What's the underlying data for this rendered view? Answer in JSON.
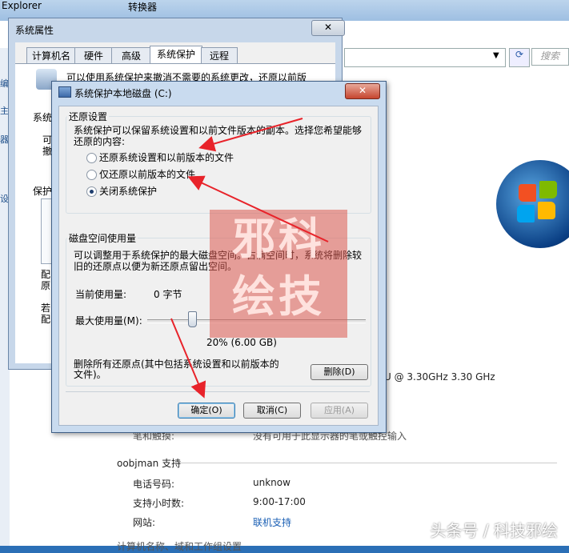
{
  "background_window": {
    "title": "Explorer",
    "title2": "转换器",
    "search_placeholder": "搜索",
    "left_labels": [
      "主",
      "编",
      "器",
      "设"
    ],
    "info": {
      "processor": "U @ 3.30GHz   3.30 GHz",
      "pen_label": "笔和触摸:",
      "pen_value": "没有可用于此显示器的笔或触控输入",
      "support_title": "oobjman 支持",
      "phone_label": "电话号码:",
      "phone_value": "unknow",
      "hours_label": "支持小时数:",
      "hours_value": "9:00-17:00",
      "site_label": "网站:",
      "site_value": "联机支持",
      "bottom_text": "计算机名称、域和工作组设置"
    }
  },
  "system_properties": {
    "title": "系统属性",
    "close": "✕",
    "tabs": [
      "计算机名",
      "硬件",
      "高级",
      "系统保护",
      "远程"
    ],
    "active_tab": "系统保护",
    "desc": "可以使用系统保护来撤消不需要的系统更改，还原以前版",
    "labels": {
      "restore": "系统",
      "line_a": "可",
      "line_b": "撤",
      "protect": "保护",
      "config_a": "配",
      "config_b": "原",
      "if_a": "若",
      "if_b": "配"
    }
  },
  "dialog": {
    "title": "系统保护本地磁盘 (C:)",
    "close": "✕",
    "restore_group": "还原设置",
    "restore_desc_1": "系统保护可以保留系统设置和以前文件版本的副本。选择您希望能够",
    "restore_desc_2": "还原的内容:",
    "options": [
      {
        "label": "还原系统设置和以前版本的文件",
        "selected": false
      },
      {
        "label": "仅还原以前版本的文件",
        "selected": false
      },
      {
        "label": "关闭系统保护",
        "selected": true
      }
    ],
    "disk_group": "磁盘空间使用量",
    "disk_desc_1": "可以调整用于系统保护的最大磁盘空间。占满空间时，系统将删除较",
    "disk_desc_2": "旧的还原点以便为新还原点留出空间。",
    "current_label": "当前使用量:",
    "current_value": "0 字节",
    "max_label": "最大使用量(M):",
    "max_fraction": 0.2,
    "max_value_text": "20% (6.00 GB)",
    "delete_desc_1": "删除所有还原点(其中包括系统设置和以前版本的",
    "delete_desc_2": "文件)。",
    "delete_button": "删除(D)",
    "ok_button": "确定(O)",
    "cancel_button": "取消(C)",
    "apply_button": "应用(A)",
    "stamp_text": "邪科绘技"
  },
  "watermark": "头条号 / 科技邪绘",
  "colors": {
    "arrow": "#e8232a"
  }
}
